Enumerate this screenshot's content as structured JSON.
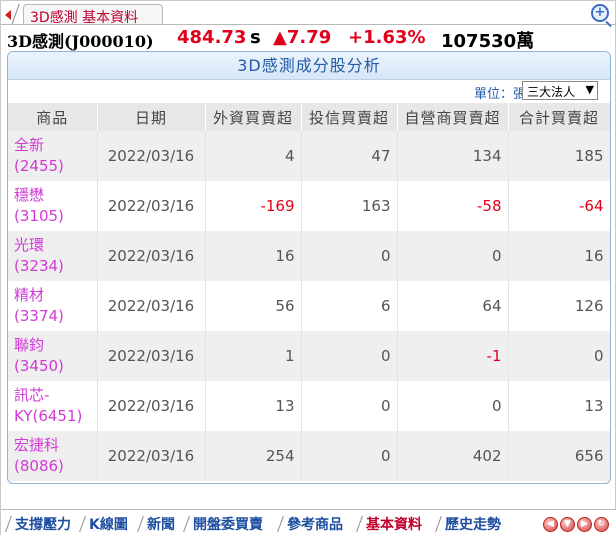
{
  "top_tab": {
    "label": "3D感測 基本資料"
  },
  "quote": {
    "name": "3D感測(J000010)",
    "price": "484.73",
    "price_flag": "s",
    "change": "▲7.79",
    "change_pct": "+1.63%",
    "volume": "107530萬"
  },
  "panel": {
    "title": "3D感測成分股分析",
    "unit_label": "單位：張",
    "unit_selected": "三大法人"
  },
  "table": {
    "headers": [
      "商品",
      "日期",
      "外資買賣超",
      "投信買賣超",
      "自營商買賣超",
      "合計買賣超"
    ],
    "rows": [
      {
        "name": "全新",
        "code": "(2455)",
        "date": "2022/03/16",
        "foreign": "4",
        "trust": "47",
        "dealer": "134",
        "total": "185"
      },
      {
        "name": "穩懋",
        "code": "(3105)",
        "date": "2022/03/16",
        "foreign": "-169",
        "trust": "163",
        "dealer": "-58",
        "total": "-64"
      },
      {
        "name": "光環",
        "code": "(3234)",
        "date": "2022/03/16",
        "foreign": "16",
        "trust": "0",
        "dealer": "0",
        "total": "16"
      },
      {
        "name": "精材",
        "code": "(3374)",
        "date": "2022/03/16",
        "foreign": "56",
        "trust": "6",
        "dealer": "64",
        "total": "126"
      },
      {
        "name": "聯鈞",
        "code": "(3450)",
        "date": "2022/03/16",
        "foreign": "1",
        "trust": "0",
        "dealer": "-1",
        "total": "0"
      },
      {
        "name": "訊芯-",
        "code": "KY(6451)",
        "date": "2022/03/16",
        "foreign": "13",
        "trust": "0",
        "dealer": "0",
        "total": "13"
      },
      {
        "name": "宏捷科",
        "code": "(8086)",
        "date": "2022/03/16",
        "foreign": "254",
        "trust": "0",
        "dealer": "402",
        "total": "656"
      }
    ]
  },
  "bottom_tabs": [
    "支撐壓力",
    "K線圖",
    "新聞",
    "開盤委買賣",
    "參考商品",
    "基本資料",
    "歷史走勢"
  ],
  "colors": {
    "accent": "#245aa8",
    "down": "#e0001b",
    "stock_link": "#d23ad6"
  }
}
